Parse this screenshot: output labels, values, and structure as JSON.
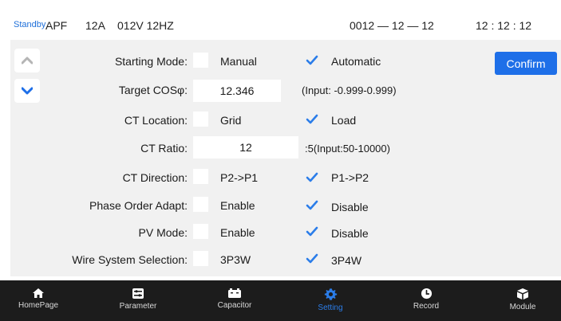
{
  "status": {
    "state": "Standby",
    "mode": "APF",
    "current": "12A",
    "voltage_freq": "012V 12HZ",
    "date": "0012 — 12 — 12",
    "time": "12 : 12 : 12"
  },
  "confirm_label": "Confirm",
  "settings": {
    "starting_mode": {
      "label": "Starting Mode:",
      "opt1": "Manual",
      "opt2": "Automatic",
      "selected": "Automatic"
    },
    "target_cos": {
      "label": "Target COSφ:",
      "value": "12.346",
      "hint": "(Input: -0.999-0.999)"
    },
    "ct_location": {
      "label": "CT Location:",
      "opt1": "Grid",
      "opt2": "Load",
      "selected": "Load"
    },
    "ct_ratio": {
      "label": "CT Ratio:",
      "value": "12",
      "hint": ":5(Input:50-10000)"
    },
    "ct_direction": {
      "label": "CT Direction:",
      "opt1": "P2->P1",
      "opt2": "P1->P2",
      "selected": "P1->P2"
    },
    "phase_order": {
      "label": "Phase Order Adapt:",
      "opt1": "Enable",
      "opt2": "Disable",
      "selected": "Disable"
    },
    "pv_mode": {
      "label": "PV Mode:",
      "opt1": "Enable",
      "opt2": "Disable",
      "selected": "Disable"
    },
    "wire_system": {
      "label": "Wire System Selection:",
      "opt1": "3P3W",
      "opt2": "3P4W",
      "selected": "3P4W"
    }
  },
  "nav": {
    "items": [
      {
        "label": "HomePage",
        "icon": "home-icon"
      },
      {
        "label": "Parameter",
        "icon": "parameter-icon"
      },
      {
        "label": "Capacitor",
        "icon": "capacitor-icon"
      },
      {
        "label": "Setting",
        "icon": "gear-icon"
      },
      {
        "label": "Record",
        "icon": "clock-icon"
      },
      {
        "label": "Module",
        "icon": "module-icon"
      }
    ],
    "active": "Setting"
  },
  "colors": {
    "accent": "#1e6fe8",
    "nav_bg": "#1c1c1c",
    "panel_bg": "#f1f1f1",
    "active_nav": "#2b7de9",
    "check": "#2b7de9"
  }
}
